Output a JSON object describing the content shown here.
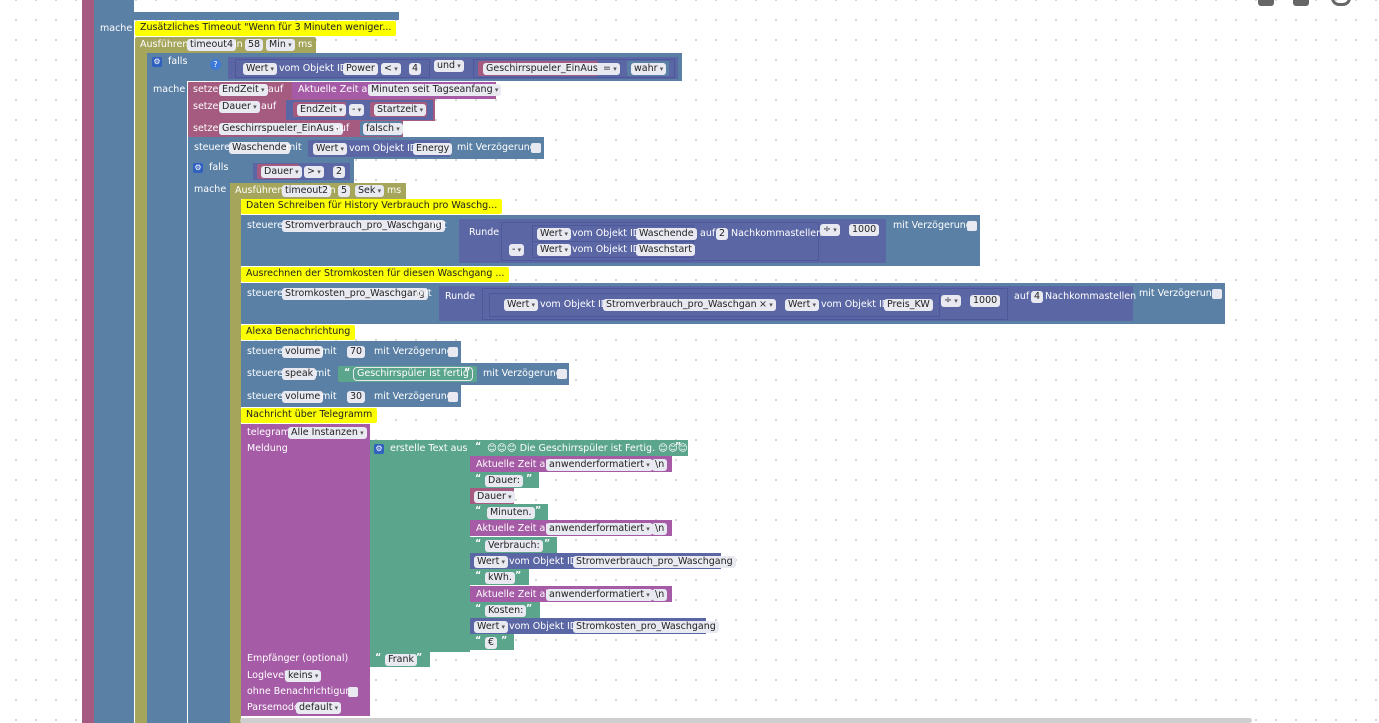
{
  "toolbar": {
    "icons": [
      "undo-icon",
      "redo-icon",
      "zoom-icon"
    ]
  },
  "outer": {
    "mache": "mache",
    "comment": "Zusätzliches Timeout \"Wenn für 3 Minuten weniger...",
    "run_label": "Ausführen",
    "timer_name": "timeout4",
    "in": "in",
    "delay": "58",
    "unit": "Min",
    "ms": "ms"
  },
  "if1": {
    "falls": "falls",
    "mache": "mache",
    "wert": "Wert",
    "vom": "vom Objekt ID",
    "obj": "Power",
    "op": "<",
    "num": "4",
    "und": "und",
    "var": "Geschirrspueler_EinAus",
    "eq": "=",
    "bool": "wahr"
  },
  "set1": {
    "setze": "setze",
    "var": "EndZeit",
    "auf": "auf",
    "expr": "Aktuelle Zeit als",
    "fmt": "Minuten seit Tagseanfang"
  },
  "set2": {
    "setze": "setze",
    "var": "Dauer",
    "auf": "auf",
    "a": "EndZeit",
    "op": "-",
    "b": "Startzeit"
  },
  "set3": {
    "setze": "setze",
    "var": "Geschirrspueler_EinAus",
    "auf": "auf",
    "val": "falsch"
  },
  "ctl1": {
    "steuere": "steuere",
    "obj": "Waschende",
    "mit": "mit",
    "wert": "Wert",
    "vom": "vom Objekt ID",
    "src": "Energy",
    "delay": "mit Verzögerung"
  },
  "if2": {
    "falls": "falls",
    "mache": "mache",
    "var": "Dauer",
    "op": ">",
    "num": "2"
  },
  "timer2": {
    "run_label": "Ausführen",
    "name": "timeout2",
    "in": "in",
    "delay": "5",
    "unit": "Sek",
    "ms": "ms"
  },
  "c1": {
    "text": "Daten Schreiben für History Verbrauch pro Waschg..."
  },
  "ctl2": {
    "steuere": "steuere",
    "obj": "Stromverbrauch_pro_Waschgang",
    "mit": "mit",
    "runde": "Runde",
    "wert": "Wert",
    "vom": "vom Objekt ID",
    "a": "Waschende",
    "minus": "-",
    "b": "Waschstart",
    "auf": "auf",
    "dec": "2",
    "nk": "Nachkommastellen",
    "div": "÷",
    "num": "1000",
    "delay": "mit Verzögerung"
  },
  "c2": {
    "text": "Ausrechnen der Stromkosten für diesen Waschgang ..."
  },
  "ctl3": {
    "steuere": "steuere",
    "obj": "Stromkosten_pro_Waschgang",
    "mit": "mit",
    "runde": "Runde",
    "wert": "Wert",
    "vom": "vom Objekt ID",
    "a": "Stromverbrauch_pro_Waschgang",
    "mul": "×",
    "b": "Preis_KW",
    "div": "÷",
    "num": "1000",
    "auf": "auf",
    "dec": "4",
    "nk": "Nachkommastellen",
    "delay": "mit Verzögerung"
  },
  "c3": {
    "text": "Alexa Benachrichtung"
  },
  "alexa": [
    {
      "steuere": "steuere",
      "obj": "volume",
      "mit": "mit",
      "val": "70",
      "delay": "mit Verzögerung"
    },
    {
      "steuere": "steuere",
      "obj": "speak",
      "mit": "mit",
      "val": "Geschirrspüler ist fertig",
      "delay": "mit Verzögerung"
    },
    {
      "steuere": "steuere",
      "obj": "volume",
      "mit": "mit",
      "val": "30",
      "delay": "mit Verzögerung"
    }
  ],
  "c4": {
    "text": "Nachricht über Telegramm"
  },
  "tg": {
    "telegram": "telegram",
    "inst": "Alle Instanzen",
    "meldung": "Meldung",
    "build": "erstelle Text aus",
    "empf": "Empfänger (optional)",
    "empf_val": "Frank",
    "log": "Loglevel",
    "log_val": "keins",
    "silent": "ohne Benachrichtigung",
    "parse": "Parsemode",
    "parse_val": "default"
  },
  "parts": {
    "p1": "😊😊😊 Die Geschirrspüler ist Fertig. 😊😊😊",
    "time_label": "Aktuelle Zeit als",
    "time_fmt": "anwenderformatiert",
    "nl": "\\n",
    "p2": "Dauer:",
    "dauer": "Dauer",
    "p3": "Minuten.",
    "p4": "Verbrauch:",
    "wert": "Wert",
    "vom": "vom Objekt ID",
    "obj1": "Stromverbrauch_pro_Waschgang",
    "p5": "kWh.",
    "p6": "Kosten:",
    "obj2": "Stromkosten_pro_Waschgang",
    "p7": "€"
  }
}
